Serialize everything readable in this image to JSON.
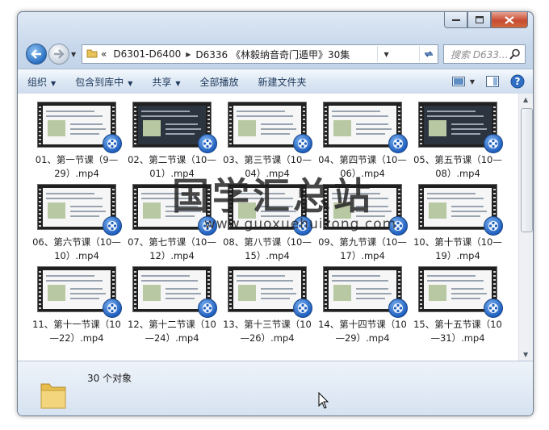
{
  "address": {
    "overflow": "«",
    "crumbs": [
      "D6301-D6400",
      "D6336 《林毅纳音奇门遁甲》30集"
    ]
  },
  "search": {
    "placeholder": "搜索 D633..."
  },
  "toolbar": {
    "organize": "组织",
    "include_library": "包含到库中",
    "share": "共享",
    "play_all": "全部播放",
    "new_folder": "新建文件夹"
  },
  "files": [
    {
      "name": "01、第一节课（9—29）.mp4"
    },
    {
      "name": "02、第二节课（10—01）.mp4"
    },
    {
      "name": "03、第三节课（10—04）.mp4"
    },
    {
      "name": "04、第四节课（10—06）.mp4"
    },
    {
      "name": "05、第五节课（10—08）.mp4"
    },
    {
      "name": "06、第六节课（10—10）.mp4"
    },
    {
      "name": "07、第七节课（10—12）.mp4"
    },
    {
      "name": "08、第八节课（10—15）.mp4"
    },
    {
      "name": "09、第九节课（10—17）.mp4"
    },
    {
      "name": "10、第十节课（10—19）.mp4"
    },
    {
      "name": "11、第十一节课（10—22）.mp4"
    },
    {
      "name": "12、第十二节课（10—24）.mp4"
    },
    {
      "name": "13、第十三节课（10—26）.mp4"
    },
    {
      "name": "14、第十四节课（10—29）.mp4"
    },
    {
      "name": "15、第十五节课（10—31）.mp4"
    }
  ],
  "status": {
    "count": "30 个对象"
  },
  "watermark": {
    "title": "国学汇总站",
    "url": "www.guoxuehuizong.com"
  },
  "colors": {
    "toolbar_text": "#1e395b",
    "accent": "#1f5fbf"
  }
}
